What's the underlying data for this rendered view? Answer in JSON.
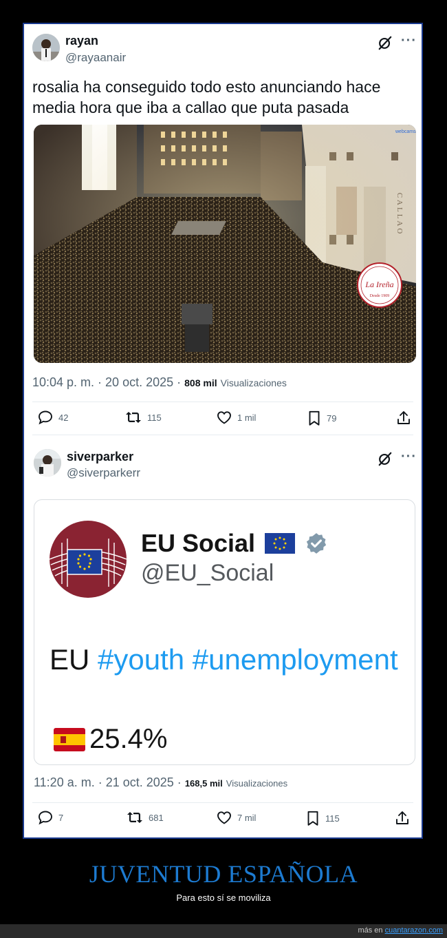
{
  "tweet1": {
    "name": "rayan",
    "handle": "@rayaanair",
    "text": "rosalia ha conseguido todo esto anunciando hace media hora que iba a callao que puta pasada",
    "time": "10:04 p. m. · 20 oct. 2025 ·",
    "views_count": "808 mil",
    "views_label": "Visualizaciones",
    "replies": "42",
    "reposts": "115",
    "likes": "1 mil",
    "bookmarks": "79",
    "photo": {
      "watermark": "La Ireña",
      "watermark_sub": "Desde 1909",
      "building_sign": "CALLAO",
      "cam_label": "webcams"
    }
  },
  "tweet2": {
    "name": "siverparker",
    "handle": "@siverparkerr",
    "time": "11:20 a. m. · 21 oct. 2025 ·",
    "views_count": "168,5 mil",
    "views_label": "Visualizaciones",
    "replies": "7",
    "reposts": "681",
    "likes": "7 mil",
    "bookmarks": "115",
    "card": {
      "name": "EU Social",
      "handle": "@EU_Social",
      "text_prefix": "EU ",
      "hashtag1": "#youth",
      "hashtag2": "#unemployment",
      "value": "25.4%"
    }
  },
  "footer": {
    "title": "JUVENTUD ESPAÑOLA",
    "subtitle": "Para esto sí se moviliza",
    "more_prefix": "más en ",
    "site": "cuantarazon.com"
  },
  "colors": {
    "link_blue": "#1d9bf0",
    "footer_blue": "#1d7bd1",
    "eu_maroon": "#8a2332",
    "eu_flag": "#1c3f9c",
    "verified_gray": "#829aab"
  },
  "icons": [
    "grok-icon",
    "more-icon",
    "reply-icon",
    "repost-icon",
    "like-icon",
    "bookmark-icon",
    "share-icon",
    "verified-icon",
    "eu-flag-icon",
    "spain-flag-icon"
  ]
}
